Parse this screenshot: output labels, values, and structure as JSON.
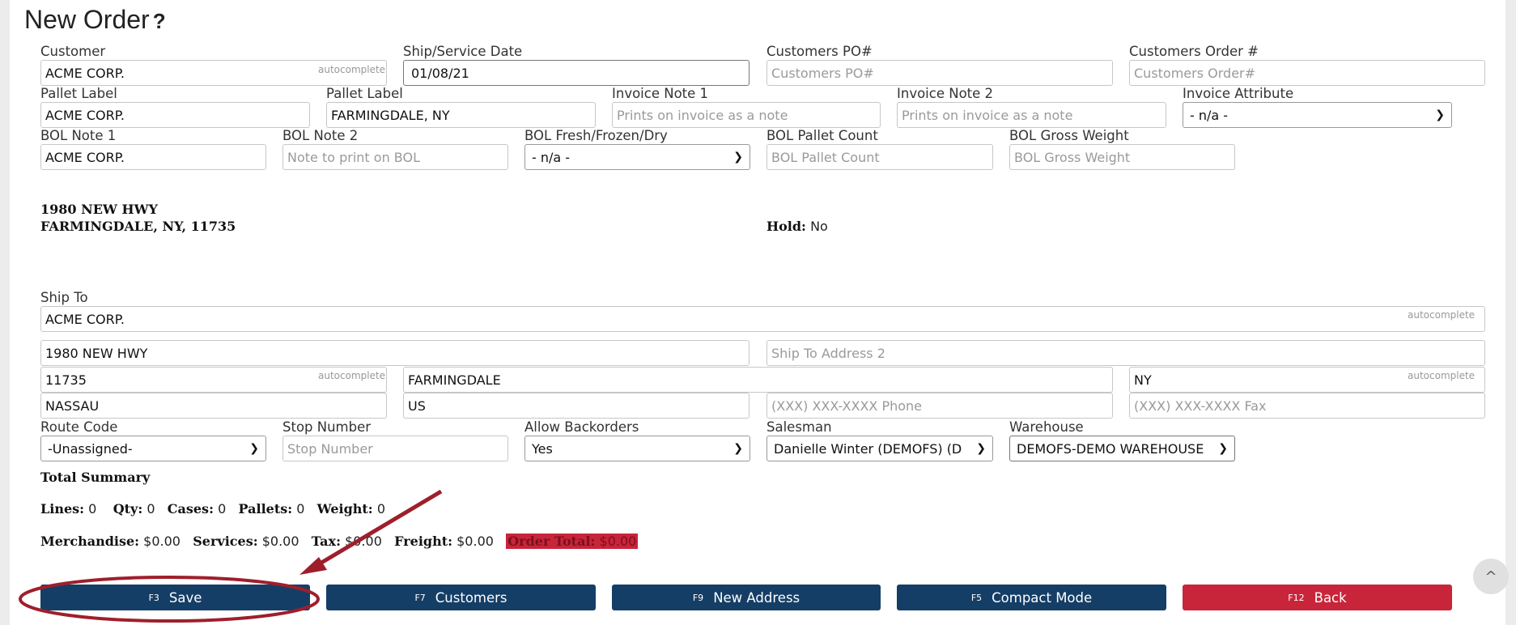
{
  "page": {
    "title": "New Order",
    "help_glyph": "?"
  },
  "fields": {
    "customer": {
      "label": "Customer",
      "value": "ACME CORP.",
      "hint": "autocomplete"
    },
    "ship_date": {
      "label": "Ship/Service Date",
      "value": "01/08/21"
    },
    "customers_po": {
      "label": "Customers PO#",
      "placeholder": "Customers PO#"
    },
    "customers_order": {
      "label": "Customers Order #",
      "placeholder": "Customers Order#"
    },
    "pallet_label_1": {
      "label": "Pallet Label",
      "value": "ACME CORP."
    },
    "pallet_label_2": {
      "label": "Pallet Label",
      "value": "FARMINGDALE, NY"
    },
    "invoice_note_1": {
      "label": "Invoice Note 1",
      "placeholder": "Prints on invoice as a note"
    },
    "invoice_note_2": {
      "label": "Invoice Note 2",
      "placeholder": "Prints on invoice as a note"
    },
    "invoice_attribute": {
      "label": "Invoice Attribute",
      "value": "- n/a -"
    },
    "bol_note_1": {
      "label": "BOL Note 1",
      "value": "ACME CORP."
    },
    "bol_note_2": {
      "label": "BOL Note 2",
      "placeholder": "Note to print on BOL"
    },
    "bol_fresh": {
      "label": "BOL Fresh/Frozen/Dry",
      "value": "- n/a -"
    },
    "bol_pallet_count": {
      "label": "BOL Pallet Count",
      "placeholder": "BOL Pallet Count"
    },
    "bol_gross_weight": {
      "label": "BOL Gross Weight",
      "placeholder": "BOL Gross Weight"
    }
  },
  "address_block": {
    "line1": "1980 NEW HWY",
    "line2": "FARMINGDALE, NY, 11735",
    "hold_label": "Hold:",
    "hold_value": "No"
  },
  "ship_to": {
    "label": "Ship To",
    "name": "ACME CORP.",
    "hint": "autocomplete",
    "address1": "1980 NEW HWY",
    "address2_placeholder": "Ship To Address 2",
    "zip": "11735",
    "city": "FARMINGDALE",
    "state": "NY",
    "county": "NASSAU",
    "country": "US",
    "phone_placeholder": "(XXX) XXX-XXXX Phone",
    "fax_placeholder": "(XXX) XXX-XXXX Fax"
  },
  "options": {
    "route_code": {
      "label": "Route Code",
      "value": "-Unassigned-"
    },
    "stop_number": {
      "label": "Stop Number",
      "placeholder": "Stop Number"
    },
    "allow_backorders": {
      "label": "Allow Backorders",
      "value": "Yes"
    },
    "salesman": {
      "label": "Salesman",
      "value": "Danielle Winter (DEMOFS) (D"
    },
    "warehouse": {
      "label": "Warehouse",
      "value": "DEMOFS-DEMO WAREHOUSE"
    }
  },
  "summary": {
    "title": "Total Summary",
    "lines_label": "Lines:",
    "lines": "0",
    "qty_label": "Qty:",
    "qty": "0",
    "cases_label": "Cases:",
    "cases": "0",
    "pallets_label": "Pallets:",
    "pallets": "0",
    "weight_label": "Weight:",
    "weight": "0",
    "merch_label": "Merchandise:",
    "merch": "$0.00",
    "services_label": "Services:",
    "services": "$0.00",
    "tax_label": "Tax:",
    "tax": "$0.00",
    "freight_label": "Freight:",
    "freight": "$0.00",
    "order_total_label": "Order Total:",
    "order_total": "$0.00"
  },
  "buttons": {
    "save": {
      "key": "F3",
      "label": "Save"
    },
    "customers": {
      "key": "F7",
      "label": "Customers"
    },
    "new_address": {
      "key": "F9",
      "label": "New Address"
    },
    "compact": {
      "key": "F5",
      "label": "Compact Mode"
    },
    "back": {
      "key": "F12",
      "label": "Back"
    }
  },
  "colors": {
    "button_blue": "#153e66",
    "button_red": "#c8253a",
    "annotation": "#9e1f2b"
  },
  "icons": {
    "scroll_top": "chevron-up-icon",
    "help": "question-mark-icon"
  }
}
